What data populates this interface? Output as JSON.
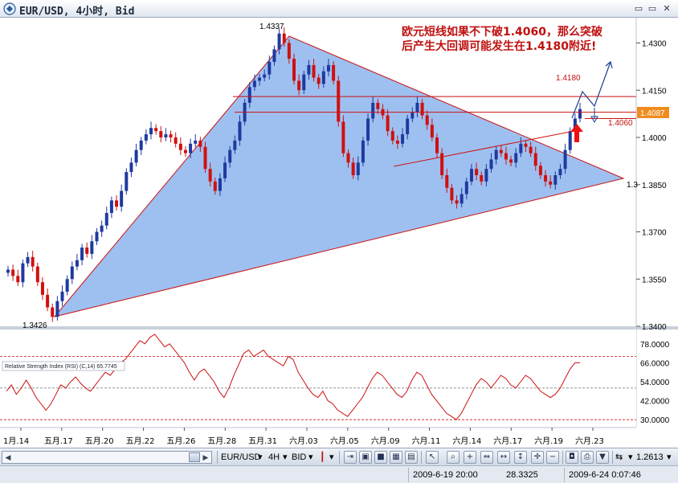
{
  "window": {
    "title": "EUR/USD, 4小时, Bid"
  },
  "annotation": {
    "line1": "欧元短线如果不下破1.4060，那么突破",
    "line2": "后产生大回调可能发生在1.4180附近!",
    "target_label": "1.4180",
    "support_label": "1.4060"
  },
  "chart_data": [
    {
      "type": "line",
      "chart_kind": "candlestick",
      "title": "",
      "y_ticks": [
        "1.4300",
        "1.4150",
        "1.4000",
        "1.3850",
        "1.3700",
        "1.3550",
        "1.3400"
      ],
      "ylim": [
        1.34,
        1.436
      ],
      "x_ticks": [
        "1月.14",
        "五月.17",
        "五月.20",
        "五月.22",
        "五月.26",
        "五月.28",
        "五月.31",
        "六月.03",
        "六月.05",
        "六月.09",
        "六月.11",
        "六月.14",
        "六月.17",
        "六月.19",
        "六月.23"
      ],
      "high_label": "1.4337",
      "low_label": "1.3426",
      "current_price": "1.4087",
      "current_price_color": "#f08c1e",
      "partial_price_label": "1.3",
      "horizontal_levels": [
        1.413,
        1.408,
        1.406
      ],
      "triangle_color": "#9ec0f0",
      "triangle_line_color": "#cc1111",
      "candles_up_color": "#1e3aa0",
      "candles_down_color": "#d01010",
      "series": [
        {
          "name": "",
          "values": [
            1.358,
            1.356,
            1.354,
            1.36,
            1.362,
            1.359,
            1.354,
            1.35,
            1.346,
            1.343,
            1.348,
            1.351,
            1.355,
            1.359,
            1.361,
            1.365,
            1.363,
            1.367,
            1.37,
            1.372,
            1.376,
            1.38,
            1.378,
            1.383,
            1.389,
            1.392,
            1.396,
            1.399,
            1.401,
            1.403,
            1.402,
            1.4,
            1.401,
            1.4,
            1.398,
            1.396,
            1.395,
            1.398,
            1.399,
            1.397,
            1.39,
            1.386,
            1.383,
            1.387,
            1.392,
            1.396,
            1.399,
            1.405,
            1.411,
            1.416,
            1.418,
            1.419,
            1.42,
            1.424,
            1.428,
            1.433,
            1.43,
            1.425,
            1.418,
            1.415,
            1.42,
            1.423,
            1.419,
            1.417,
            1.421,
            1.423,
            1.418,
            1.405,
            1.395,
            1.392,
            1.388,
            1.392,
            1.399,
            1.406,
            1.411,
            1.409,
            1.407,
            1.402,
            1.399,
            1.398,
            1.401,
            1.406,
            1.408,
            1.411,
            1.407,
            1.404,
            1.4,
            1.395,
            1.388,
            1.384,
            1.38,
            1.379,
            1.382,
            1.386,
            1.39,
            1.388,
            1.386,
            1.39,
            1.393,
            1.396,
            1.395,
            1.393,
            1.392,
            1.395,
            1.398,
            1.397,
            1.395,
            1.391,
            1.388,
            1.386,
            1.385,
            1.388,
            1.39,
            1.396,
            1.402,
            1.406,
            1.409
          ]
        }
      ]
    },
    {
      "type": "line",
      "title": "Relative Strength Index (RSI) (C,14) 65.7745",
      "y_ticks": [
        "78.0000",
        "66.0000",
        "54.0000",
        "42.0000",
        "30.0000"
      ],
      "ylim": [
        25,
        85
      ],
      "reference_levels": [
        70,
        50,
        30
      ],
      "current_label": "66.0000",
      "series": [
        {
          "name": "RSI (C,14)",
          "values": [
            48,
            52,
            46,
            50,
            55,
            50,
            44,
            40,
            36,
            40,
            46,
            52,
            50,
            54,
            57,
            53,
            50,
            48,
            52,
            56,
            60,
            58,
            62,
            66,
            68,
            72,
            76,
            80,
            78,
            82,
            84,
            80,
            76,
            78,
            74,
            70,
            66,
            60,
            55,
            60,
            62,
            58,
            54,
            48,
            44,
            50,
            58,
            65,
            72,
            74,
            70,
            72,
            74,
            70,
            68,
            66,
            64,
            70,
            68,
            60,
            55,
            50,
            46,
            44,
            48,
            42,
            40,
            36,
            34,
            32,
            36,
            40,
            44,
            50,
            56,
            60,
            58,
            54,
            50,
            46,
            44,
            48,
            55,
            60,
            58,
            52,
            46,
            42,
            38,
            34,
            32,
            30,
            34,
            40,
            46,
            52,
            56,
            54,
            50,
            54,
            58,
            56,
            52,
            50,
            54,
            58,
            56,
            52,
            48,
            46,
            44,
            46,
            50,
            56,
            62,
            66,
            66
          ]
        }
      ]
    }
  ],
  "toolbar": {
    "instrument": "EUR/USD",
    "period": "4H",
    "price_type": "BID",
    "value": "1.2613"
  },
  "status": {
    "left_time": "2009-6-19 20:00",
    "left_value": "28.3325",
    "right_time": "2009-6-24 0:07:46"
  }
}
